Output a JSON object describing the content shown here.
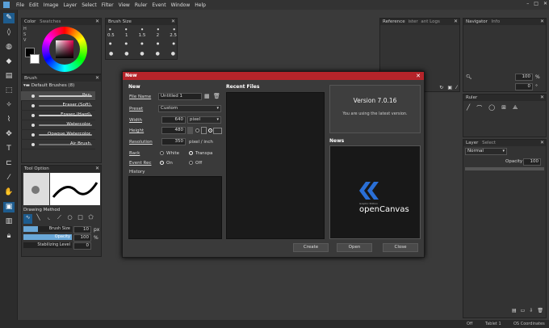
{
  "menu": [
    "File",
    "Edit",
    "Image",
    "Layer",
    "Select",
    "Filter",
    "View",
    "Ruler",
    "Event",
    "Window",
    "Help"
  ],
  "window_controls": {
    "minimize": "–",
    "maximize": "□",
    "close": "✕"
  },
  "color_panel": {
    "tabs": [
      "Color",
      "Swatches"
    ],
    "labels": [
      "H",
      "S",
      "V",
      "R",
      "G",
      "B"
    ]
  },
  "brush_size_panel": {
    "title": "Brush Size",
    "sizes": [
      "0.5",
      "1",
      "1.5",
      "2",
      "2.5"
    ]
  },
  "brush_panel": {
    "title": "Brush",
    "group": "Default Brushes (8)",
    "items": [
      "Pen",
      "Eraser (Soft)",
      "Eraser (Hard)",
      "Watercolor",
      "Opaque Watercolor",
      "Air Brush"
    ],
    "selected_index": 0
  },
  "tool_option": {
    "title": "Tool Option",
    "drawing_method": "Drawing Method",
    "brush_size_label": "Brush Size",
    "brush_size_value": "10",
    "brush_size_unit": "px",
    "opacity_label": "Opacity",
    "opacity_value": "100",
    "opacity_unit": "%",
    "stabilizing_label": "Stabilizing Level",
    "stabilizing_value": "0"
  },
  "reference_panel": {
    "tabs": [
      "Reference",
      "ister",
      "ant Logs"
    ]
  },
  "navigator_panel": {
    "tabs": [
      "Navigator",
      "Info"
    ],
    "zoom": "100",
    "zoom_unit": "%",
    "rotate": "0",
    "rotate_unit": "°"
  },
  "ruler_panel": {
    "title": "Ruler"
  },
  "layer_panel": {
    "tabs": [
      "Layer",
      "Select"
    ],
    "blend_mode": "Normal",
    "opacity_label": "Opacity",
    "opacity_value": "100"
  },
  "dialog": {
    "title": "New",
    "close": "✕",
    "section_new": "New",
    "section_recent": "Recent Files",
    "section_news": "News",
    "file_name_label": "File Name",
    "file_name_value": "Untitled 1",
    "preset_label": "Preset",
    "preset_value": "Custom",
    "width_label": "Width",
    "width_value": "640",
    "unit_value": "pixel",
    "height_label": "Height",
    "height_value": "480",
    "resolution_label": "Resolution",
    "resolution_value": "350",
    "resolution_unit": "pixel / inch",
    "back_label": "Back",
    "back_white": "White",
    "back_transparent": "Transpa",
    "event_label": "Event Rec",
    "event_on": "On",
    "event_off": "Off",
    "history_label": "History",
    "version": "Version 7.0.16",
    "version_msg": "You are using the latest version.",
    "logo_small": "Graphic Edition",
    "logo_text": "openCanvas",
    "buttons": {
      "create": "Create",
      "open": "Open",
      "close": "Close"
    }
  },
  "status": {
    "off": "Off",
    "tablet": "Tablet 1",
    "os": "OS Coordinates"
  },
  "colors": {
    "accent": "#1e5c8e",
    "dialog_title": "#b5242a",
    "logo_blue": "#2a6fd6"
  }
}
